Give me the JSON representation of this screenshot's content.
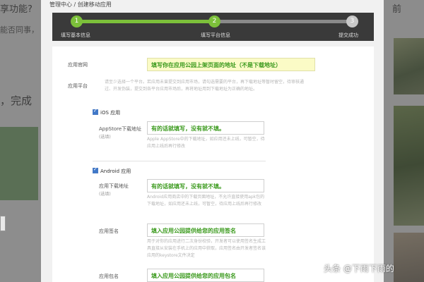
{
  "background": {
    "left_title": "享功能?",
    "left_sub": "能否同事，",
    "left_text": "，完成",
    "right_title": "前"
  },
  "breadcrumb": "管理中心 / 创建移动应用",
  "steps": [
    {
      "num": "1",
      "label": "填写基本信息",
      "state": "done"
    },
    {
      "num": "2",
      "label": "填写平台信息",
      "state": "current"
    },
    {
      "num": "3",
      "label": "提交成功",
      "state": "todo"
    }
  ],
  "form": {
    "website": {
      "label": "应用官网",
      "value": "填写你在应用公园上架页面的地址（不是下载地址）"
    },
    "platform": {
      "label": "应用平台",
      "hint": "请至少选择一个平台。若应用未曾提交到应用市场，请勾选需要的平台，再下载地址等暂时留空，待审核通过、开发伪装，提交到各平台应用市场后，再将地址用到下载地址为正确的地址。"
    },
    "ios": {
      "checkbox_label": "iOS 应用",
      "appstore_label": "AppStore下载地址",
      "appstore_sublabel": "(选填)",
      "appstore_value": "有的话就填写，没有就不填。",
      "appstore_hint": "Apple AppStore中的下载地址，如应用还未上线，可暂空，待应用上线后再行修改"
    },
    "android": {
      "checkbox_label": "Android 应用",
      "download_label": "应用下载地址",
      "download_sublabel": "(选填)",
      "download_value": "有的话就填写，没有就不填。",
      "download_hint": "Android应用商店中的下载页面地址，不允许直接使用apk包的下载地址，如应用还未上线，可暂空，待应用上线后再行修改",
      "signature_label": "应用签名",
      "signature_value": "填入应用公园提供给您的应用签名",
      "signature_hint": "用于对你的应用进行二次身份校验，开发者可以使用签名生成工具直接从安装在手机上的应用中获取，应用签名由开发者签名该应用的keystore文件决定",
      "package_label": "应用包名",
      "package_value": "填入应用公园提供给您的应用包名"
    }
  },
  "watermark": "头条 @下雨下雨的",
  "colors": {
    "accent_green": "#7cc03a",
    "value_green": "#3b9a1d",
    "highlight_yellow": "#fbfbc6",
    "stepbar_bg": "#3a3a3a"
  }
}
